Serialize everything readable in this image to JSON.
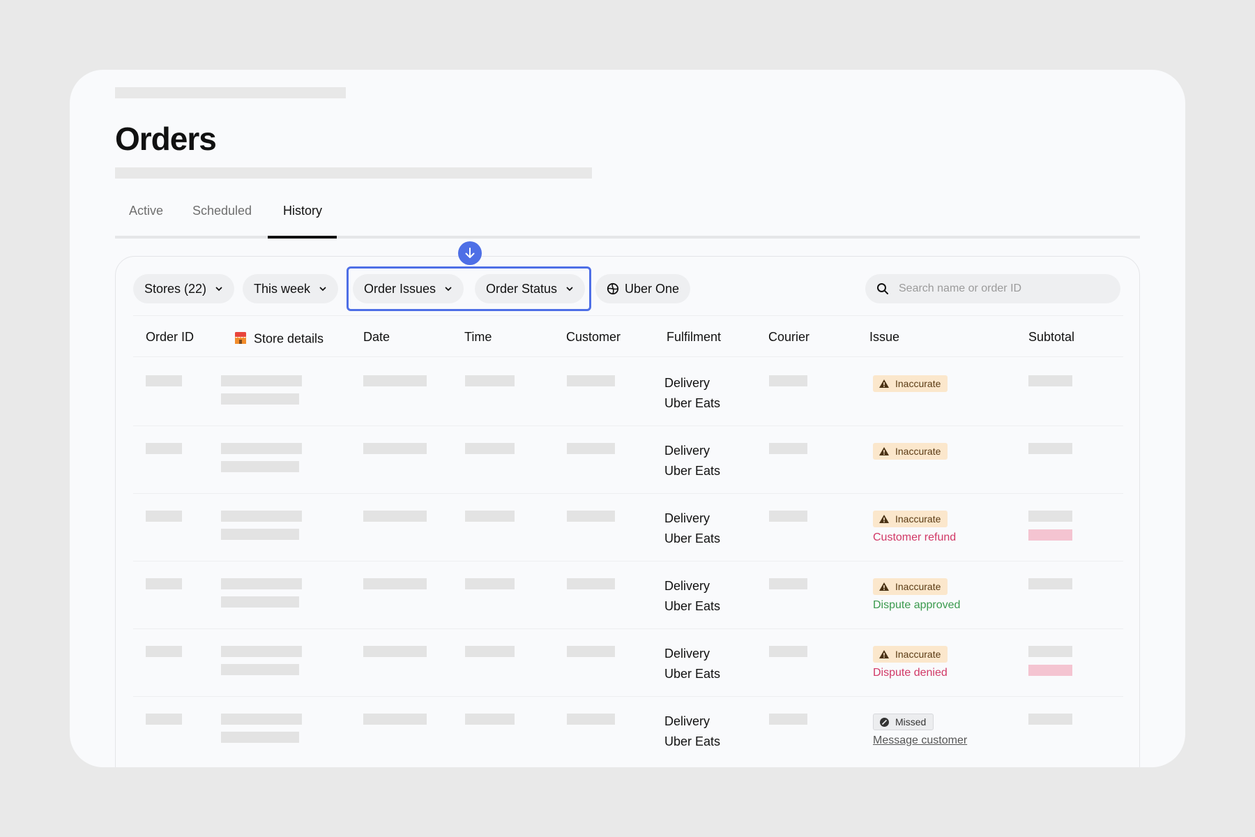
{
  "page": {
    "title": "Orders"
  },
  "tabs": [
    {
      "label": "Active",
      "active": false
    },
    {
      "label": "Scheduled",
      "active": false
    },
    {
      "label": "History",
      "active": true
    }
  ],
  "filters": {
    "stores": "Stores (22)",
    "week": "This week",
    "order_issues": "Order Issues",
    "order_status": "Order Status",
    "uber_one": "Uber One"
  },
  "search": {
    "placeholder": "Search name or order ID",
    "value": ""
  },
  "table": {
    "headers": [
      "Order ID",
      "Store details",
      "Date",
      "Time",
      "Customer",
      "Fulfilment",
      "Courier",
      "Issue",
      "Subtotal"
    ],
    "rows": [
      {
        "fulfilment_type": "Delivery",
        "fulfilment_channel": "Uber Eats",
        "issue_badge": "Inaccurate",
        "issue_kind": "warn",
        "issue_detail": "",
        "detail_style": "",
        "subtotal_adjusted": false
      },
      {
        "fulfilment_type": "Delivery",
        "fulfilment_channel": "Uber Eats",
        "issue_badge": "Inaccurate",
        "issue_kind": "warn",
        "issue_detail": "",
        "detail_style": "",
        "subtotal_adjusted": false
      },
      {
        "fulfilment_type": "Delivery",
        "fulfilment_channel": "Uber Eats",
        "issue_badge": "Inaccurate",
        "issue_kind": "warn",
        "issue_detail": "Customer refund",
        "detail_style": "red",
        "subtotal_adjusted": true
      },
      {
        "fulfilment_type": "Delivery",
        "fulfilment_channel": "Uber Eats",
        "issue_badge": "Inaccurate",
        "issue_kind": "warn",
        "issue_detail": "Dispute approved",
        "detail_style": "green",
        "subtotal_adjusted": false
      },
      {
        "fulfilment_type": "Delivery",
        "fulfilment_channel": "Uber Eats",
        "issue_badge": "Inaccurate",
        "issue_kind": "warn",
        "issue_detail": "Dispute denied",
        "detail_style": "red",
        "subtotal_adjusted": true
      },
      {
        "fulfilment_type": "Delivery",
        "fulfilment_channel": "Uber Eats",
        "issue_badge": "Missed",
        "issue_kind": "missed",
        "issue_detail": "Message customer",
        "detail_style": "link",
        "subtotal_adjusted": false
      }
    ]
  },
  "colors": {
    "accent": "#4e6fe6",
    "warning_bg": "#fbe7cc",
    "refund_red": "#d13866",
    "approved_green": "#3a9a4d",
    "skeleton": "#e3e3e3"
  },
  "icons": {
    "download": "arrow-down-icon",
    "search": "search-icon",
    "globe": "globe-icon",
    "chevron": "chevron-down-icon",
    "store": "store-icon",
    "warning": "warning-triangle-icon",
    "missed": "missed-icon"
  }
}
